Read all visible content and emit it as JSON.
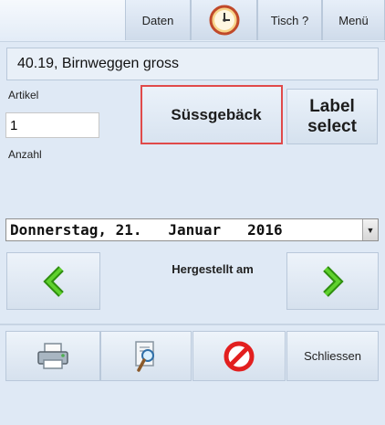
{
  "toolbar": {
    "data_label": "Daten",
    "table_label": "Tisch ?",
    "menu_label": "Menü"
  },
  "article": {
    "name": "40.19, Birnweggen gross",
    "article_label": "Artikel",
    "amount_value": "1",
    "amount_label": "Anzahl"
  },
  "category": {
    "name": "Süssgebäck",
    "label_select": "Label\nselect"
  },
  "date": {
    "selected": "Donnerstag, 21.   Januar   2016"
  },
  "production": {
    "label": "Hergestellt am"
  },
  "actions": {
    "close_label": "Schliessen"
  },
  "colors": {
    "background": "#dfe9f5",
    "selected_border": "#e04a4a",
    "arrow_green": "#3db814"
  }
}
